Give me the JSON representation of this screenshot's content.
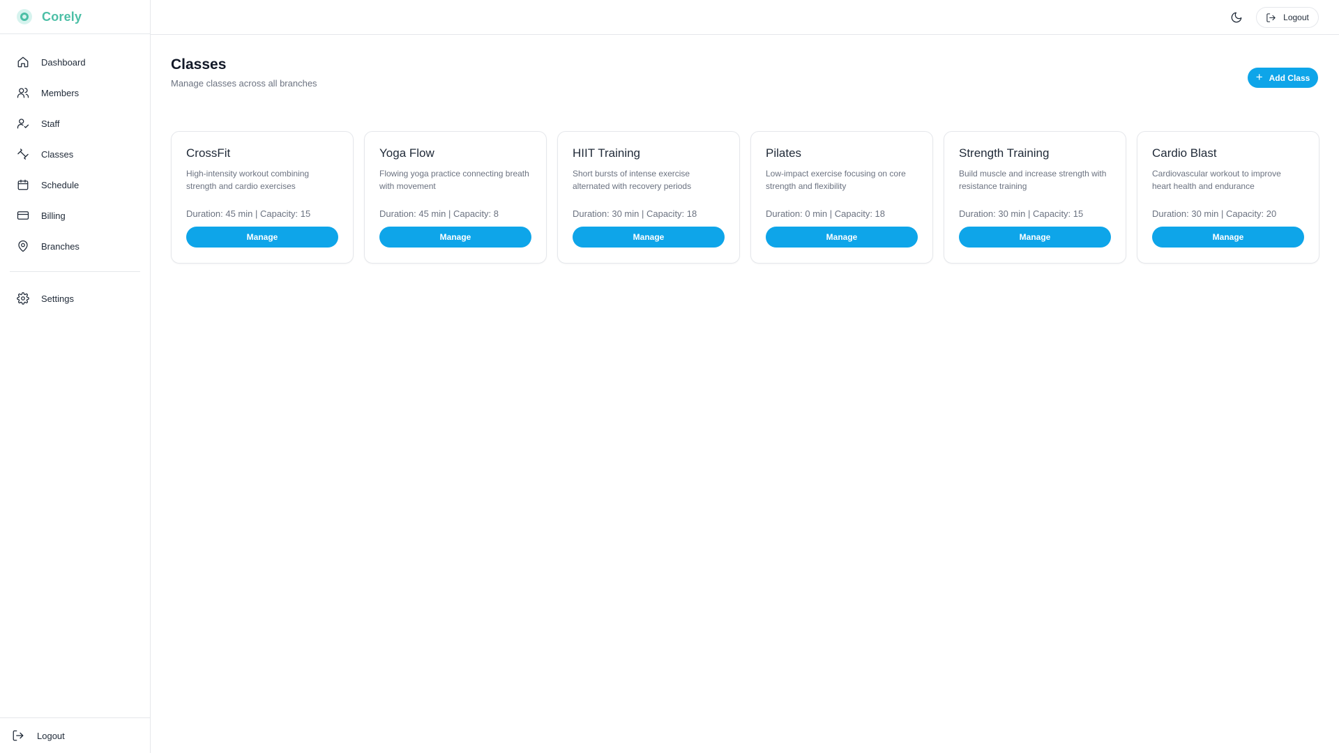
{
  "brand": {
    "name": "Corely",
    "accent": "#4cbfa6"
  },
  "sidebar": {
    "items": [
      {
        "label": "Dashboard",
        "icon": "home-icon"
      },
      {
        "label": "Members",
        "icon": "users-icon"
      },
      {
        "label": "Staff",
        "icon": "user-check-icon"
      },
      {
        "label": "Classes",
        "icon": "dumbbell-icon"
      },
      {
        "label": "Schedule",
        "icon": "calendar-icon"
      },
      {
        "label": "Billing",
        "icon": "credit-card-icon"
      },
      {
        "label": "Branches",
        "icon": "map-pin-icon"
      }
    ],
    "settings": {
      "label": "Settings",
      "icon": "gear-icon"
    },
    "logout": {
      "label": "Logout",
      "icon": "logout-icon"
    }
  },
  "header": {
    "theme_toggle_icon": "moon-icon",
    "logout_label": "Logout"
  },
  "page": {
    "title": "Classes",
    "subtitle": "Manage classes across all branches",
    "add_button_label": "Add Class",
    "primary_color": "#0ea5e9"
  },
  "classes": [
    {
      "name": "CrossFit",
      "description": "High-intensity workout combining strength and cardio exercises",
      "meta": "Duration: 45 min | Capacity: 15",
      "button": "Manage"
    },
    {
      "name": "Yoga Flow",
      "description": "Flowing yoga practice connecting breath with movement",
      "meta": "Duration: 45 min | Capacity: 8",
      "button": "Manage"
    },
    {
      "name": "HIIT Training",
      "description": "Short bursts of intense exercise alternated with recovery periods",
      "meta": "Duration: 30 min | Capacity: 18",
      "button": "Manage"
    },
    {
      "name": "Pilates",
      "description": "Low-impact exercise focusing on core strength and flexibility",
      "meta": "Duration: 0 min | Capacity: 18",
      "button": "Manage"
    },
    {
      "name": "Strength Training",
      "description": "Build muscle and increase strength with resistance training",
      "meta": "Duration: 30 min | Capacity: 15",
      "button": "Manage"
    },
    {
      "name": "Cardio Blast",
      "description": "Cardiovascular workout to improve heart health and endurance",
      "meta": "Duration: 30 min | Capacity: 20",
      "button": "Manage"
    }
  ]
}
